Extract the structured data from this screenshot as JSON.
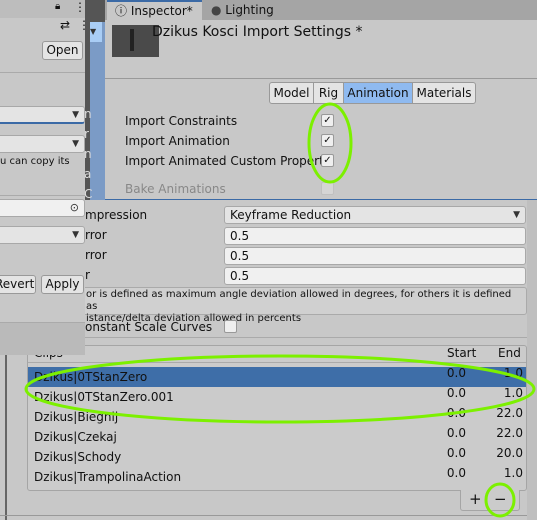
{
  "left_panel": {
    "open_label": "Open",
    "help_text": "u can copy its",
    "revert_label": "Revert",
    "apply_label": "Apply"
  },
  "clipped_labels": [
    "n",
    "r",
    "n",
    "a",
    "C"
  ],
  "inspector": {
    "tabs": [
      {
        "label": "Inspector*",
        "active": true
      },
      {
        "label": "Lighting",
        "active": false
      }
    ],
    "title": "Dzikus Kosci Import Settings *",
    "section_tabs": [
      {
        "label": "Model"
      },
      {
        "label": "Rig"
      },
      {
        "label": "Animation",
        "active": true
      },
      {
        "label": "Materials"
      }
    ],
    "options": [
      {
        "label": "Import Constraints",
        "checked": true
      },
      {
        "label": "Import Animation",
        "checked": true
      },
      {
        "label": "Import Animated Custom Propert",
        "checked": true
      },
      {
        "label": "Bake Animations",
        "checked": false,
        "disabled": true
      }
    ]
  },
  "compression": {
    "label": "mpression",
    "value": "Keyframe Reduction"
  },
  "errors": [
    {
      "label": "rror",
      "value": "0.5"
    },
    {
      "label": "rror",
      "value": "0.5"
    },
    {
      "label": "r",
      "value": "0.5"
    }
  ],
  "help_text": [
    "or is defined as maximum angle deviation allowed in degrees, for others it is defined as",
    "istance/delta deviation allowed in percents"
  ],
  "constant_scale": {
    "label": "onstant Scale Curves",
    "checked": false
  },
  "clips": {
    "header": {
      "name": "Clips",
      "start": "Start",
      "end": "End"
    },
    "rows": [
      {
        "name": "Dzikus|0TStanZero",
        "start": "0.0",
        "end": "1.0",
        "selected": true
      },
      {
        "name": "Dzikus|0TStanZero.001",
        "start": "0.0",
        "end": "1.0"
      },
      {
        "name": "Dzikus|Biegnij",
        "start": "0.0",
        "end": "22.0"
      },
      {
        "name": "Dzikus|Czekaj",
        "start": "0.0",
        "end": "22.0"
      },
      {
        "name": "Dzikus|Schody",
        "start": "0.0",
        "end": "20.0"
      },
      {
        "name": "Dzikus|TrampolinaAction",
        "start": "0.0",
        "end": "1.0"
      }
    ],
    "add_label": "+",
    "remove_label": "−"
  },
  "colors": {
    "selection": "#3e6ea8",
    "active_tab": "#8fbaf0",
    "highlight": "#7cf000"
  }
}
